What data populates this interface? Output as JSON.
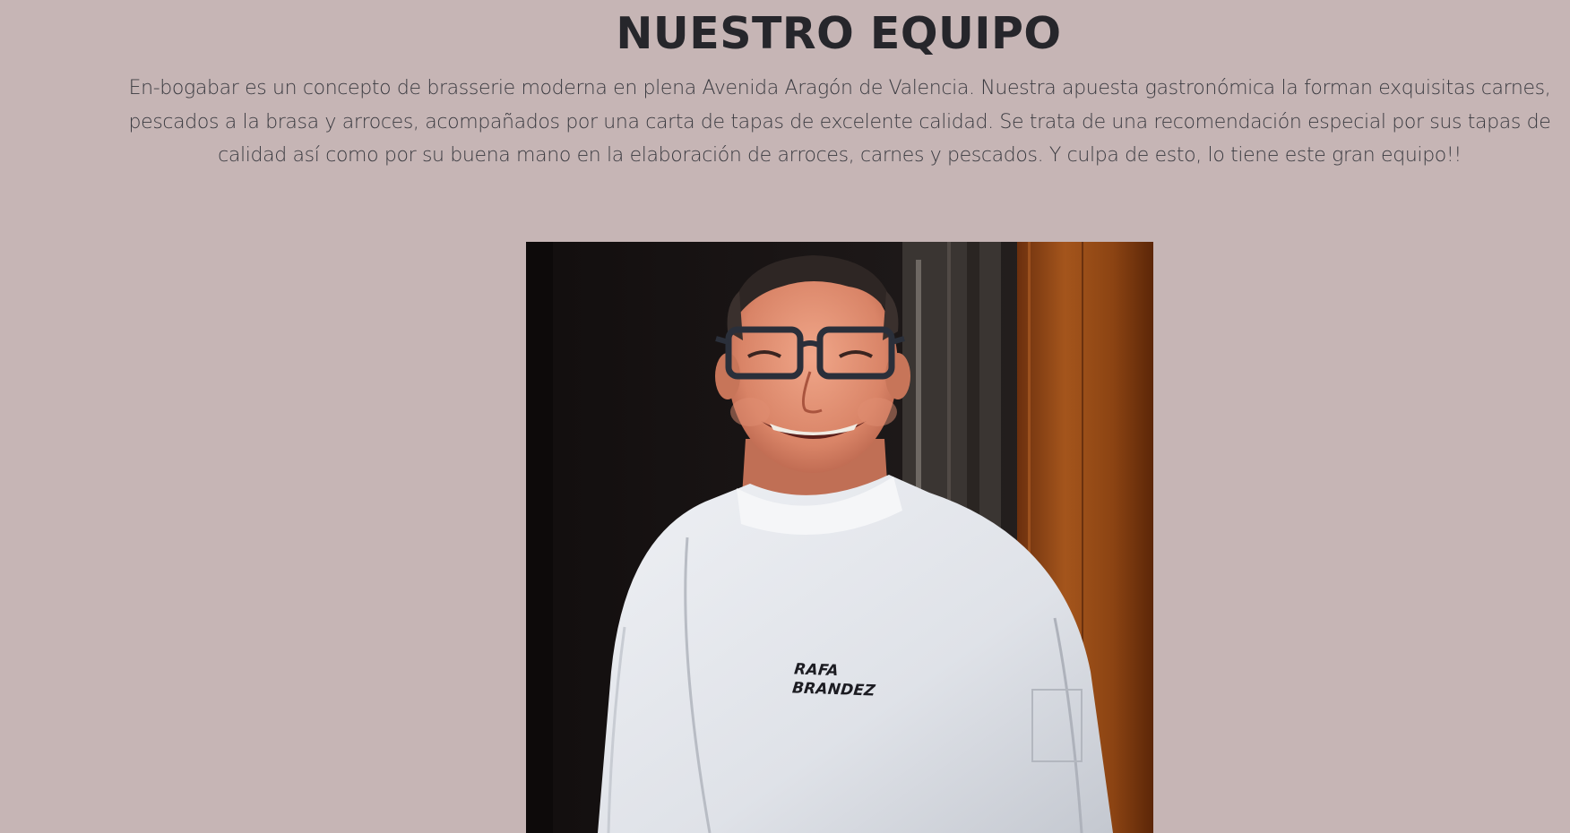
{
  "team_section": {
    "title": "NUESTRO EQUIPO",
    "description": "En-bogabar es un concepto de brasserie moderna en plena Avenida Aragón de Valencia. Nuestra apuesta gastronómica la forman exquisitas carnes, pescados a la brasa y arroces, acompañados por una carta de tapas de excelente calidad. Se trata de una recomendación especial por sus tapas de calidad así como por su buena mano en la elaboración de arroces, carnes y pescados. Y culpa de esto, lo tiene este gran equipo!!",
    "photo": {
      "jacket_logo_line1": "RAFA",
      "jacket_logo_line2": "BRANDEZ"
    }
  },
  "colors": {
    "background": "#c6b5b5",
    "title_text": "#26262b",
    "body_text": "#3a3a40"
  }
}
